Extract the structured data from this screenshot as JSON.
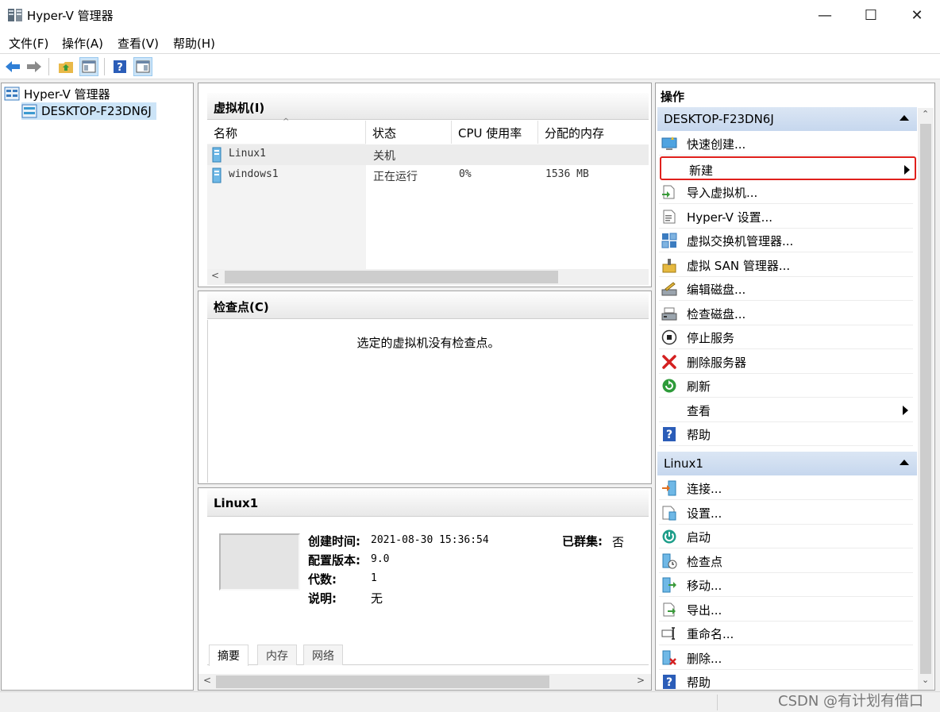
{
  "window": {
    "title": "Hyper-V 管理器",
    "min_glyph": "—",
    "max_glyph": "☐",
    "close_glyph": "✕"
  },
  "menu": [
    "文件(F)",
    "操作(A)",
    "查看(V)",
    "帮助(H)"
  ],
  "tree": {
    "root": "Hyper-V 管理器",
    "host": "DESKTOP-F23DN6J"
  },
  "vm_panel": {
    "title": "虚拟机(I)",
    "columns": [
      "名称",
      "状态",
      "CPU 使用率",
      "分配的内存"
    ],
    "rows": [
      {
        "name": "Linux1",
        "state": "关机",
        "cpu": "",
        "memory": ""
      },
      {
        "name": "windows1",
        "state": "正在运行",
        "cpu": "0%",
        "memory": "1536 MB"
      }
    ]
  },
  "checkpoint_panel": {
    "title": "检查点(C)",
    "empty_message": "选定的虚拟机没有检查点。"
  },
  "details": {
    "title": "Linux1",
    "created_label": "创建时间:",
    "created_value": "2021-08-30 15:36:54",
    "clustered_label": "已群集:",
    "clustered_value": "否",
    "config_label": "配置版本:",
    "config_value": "9.0",
    "generation_label": "代数:",
    "generation_value": "1",
    "notes_label": "说明:",
    "notes_value": "无",
    "tabs": [
      "摘要",
      "内存",
      "网络"
    ]
  },
  "actions": {
    "title": "操作",
    "host_group": "DESKTOP-F23DN6J",
    "host_items": [
      {
        "label": "快速创建...",
        "icon": "quick-create-icon"
      },
      {
        "label": "新建",
        "icon": "none",
        "submenu": true,
        "highlighted": true
      },
      {
        "label": "导入虚拟机...",
        "icon": "import-icon"
      },
      {
        "label": "Hyper-V 设置...",
        "icon": "settings-icon"
      },
      {
        "label": "虚拟交换机管理器...",
        "icon": "switch-icon"
      },
      {
        "label": "虚拟 SAN 管理器...",
        "icon": "san-icon"
      },
      {
        "label": "编辑磁盘...",
        "icon": "edit-disk-icon"
      },
      {
        "label": "检查磁盘...",
        "icon": "inspect-disk-icon"
      },
      {
        "label": "停止服务",
        "icon": "stop-icon"
      },
      {
        "label": "删除服务器",
        "icon": "remove-icon"
      },
      {
        "label": "刷新",
        "icon": "refresh-icon"
      },
      {
        "label": "查看",
        "icon": "none",
        "submenu": true
      },
      {
        "label": "帮助",
        "icon": "help-icon"
      }
    ],
    "vm_group": "Linux1",
    "vm_items": [
      {
        "label": "连接...",
        "icon": "connect-icon"
      },
      {
        "label": "设置...",
        "icon": "vm-settings-icon"
      },
      {
        "label": "启动",
        "icon": "start-icon"
      },
      {
        "label": "检查点",
        "icon": "checkpoint-icon"
      },
      {
        "label": "移动...",
        "icon": "move-icon"
      },
      {
        "label": "导出...",
        "icon": "export-icon"
      },
      {
        "label": "重命名...",
        "icon": "rename-icon"
      },
      {
        "label": "删除...",
        "icon": "delete-icon"
      },
      {
        "label": "帮助",
        "icon": "help-icon"
      }
    ]
  },
  "watermark": "CSDN @有计划有借口",
  "colors": {
    "highlight_border": "#e0201c",
    "group_header": "#c6d7ee",
    "selection": "#cce4f7"
  }
}
